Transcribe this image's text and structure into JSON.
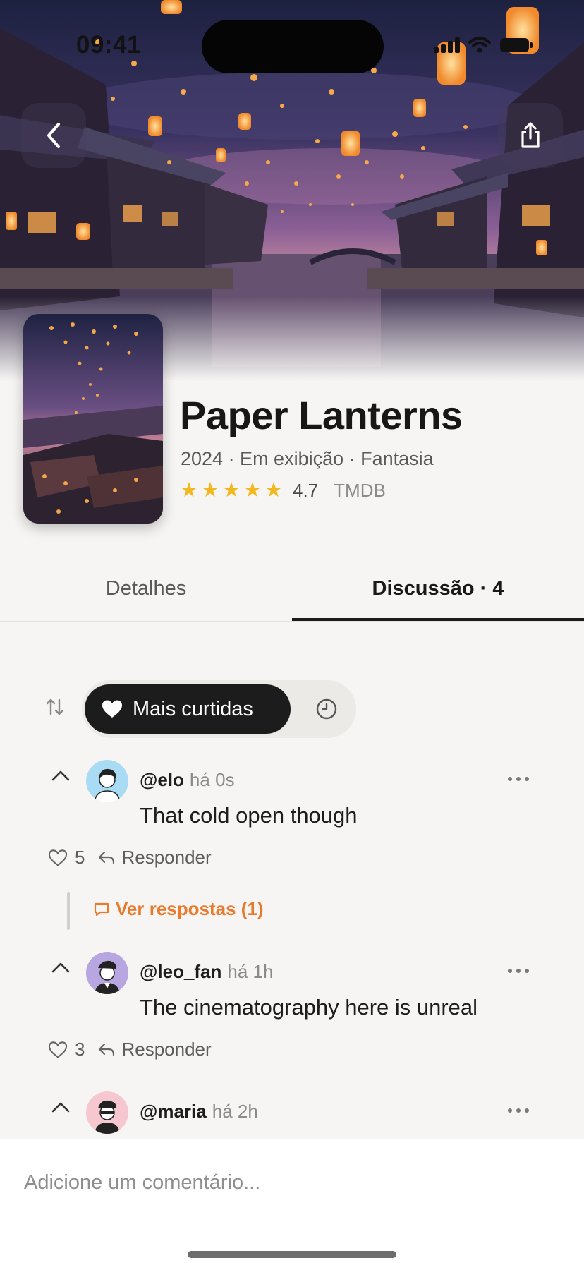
{
  "status_bar": {
    "time": "09:41"
  },
  "hero": {
    "back_icon": "chevron-left-icon",
    "share_icon": "share-icon"
  },
  "show": {
    "title": "Paper Lanterns",
    "meta": "2024 · Em exibição · Fantasia",
    "stars": 5,
    "rating": "4.7",
    "rating_source": "TMDB"
  },
  "tabs": [
    {
      "label": "Detalhes",
      "active": false
    },
    {
      "label": "Discussão · 4",
      "active": true
    }
  ],
  "sort": {
    "active_label": "Mais curtidas",
    "active_icon": "heart-icon",
    "inactive_icon": "clock-icon",
    "toggle_icon": "sort-arrows-icon"
  },
  "comments": [
    {
      "username": "@elo",
      "time": "há 0s",
      "text": "That cold open though",
      "likes": "5",
      "reply_label": "Responder",
      "replies_label": "Ver respostas (1)",
      "avatar_color": "#a9dcf4"
    },
    {
      "username": "@leo_fan",
      "time": "há 1h",
      "text": "The cinematography here is unreal",
      "likes": "3",
      "reply_label": "Responder",
      "avatar_color": "#b8a6e0"
    },
    {
      "username": "@maria",
      "time": "há 2h",
      "avatar_color": "#f6c7cf"
    }
  ],
  "composer": {
    "placeholder": "Adicione um comentário..."
  },
  "colors": {
    "accent_orange": "#e77a2d",
    "star": "#f2b91e",
    "dark": "#1c1c1c"
  }
}
